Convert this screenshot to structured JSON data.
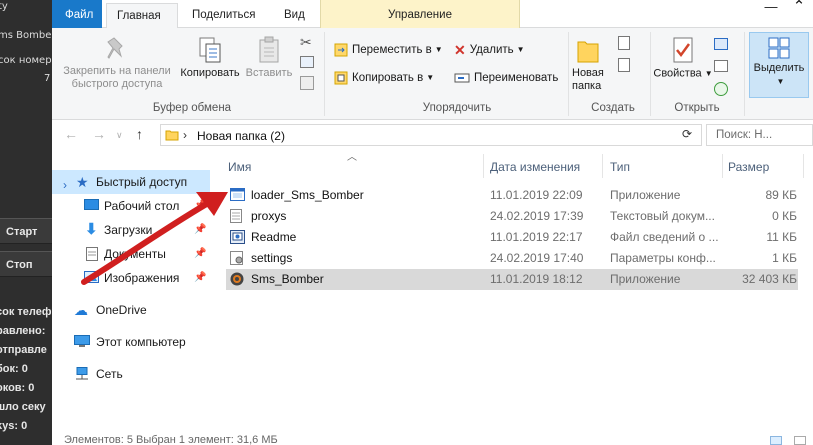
{
  "background_app": {
    "lines": [
      "ty",
      "ms Bombe",
      "сок номерс",
      "7"
    ],
    "buttons": [
      "Старт",
      "Стоп"
    ],
    "stats": [
      "сок телеф",
      "равлено:",
      "отправле",
      "бок: 0",
      "оков: 0",
      "шло секу",
      "kys: 0"
    ]
  },
  "tabs": {
    "file": "Файл",
    "home": "Главная",
    "share": "Поделиться",
    "view": "Вид",
    "manage": "Управление"
  },
  "ribbon": {
    "clipboard": {
      "pin": "Закрепить на панели быстрого доступа",
      "copy": "Копировать",
      "paste": "Вставить",
      "label": "Буфер обмена"
    },
    "organize": {
      "move_to": "Переместить в",
      "copy_to": "Копировать в",
      "delete": "Удалить",
      "rename": "Переименовать",
      "label": "Упорядочить"
    },
    "new": {
      "new_folder": "Новая папка",
      "label": "Создать"
    },
    "open": {
      "properties": "Свойства",
      "label": "Открыть"
    },
    "select": {
      "select": "Выделить"
    }
  },
  "address": {
    "path": "Новая папка (2)",
    "search_placeholder": "Поиск: Н..."
  },
  "nav": {
    "quick_access": "Быстрый доступ",
    "desktop": "Рабочий стол",
    "downloads": "Загрузки",
    "documents": "Документы",
    "pictures": "Изображения",
    "onedrive": "OneDrive",
    "this_pc": "Этот компьютер",
    "network": "Сеть"
  },
  "columns": {
    "name": "Имя",
    "date": "Дата изменения",
    "type": "Тип",
    "size": "Размер"
  },
  "files": [
    {
      "name": "loader_Sms_Bomber",
      "date": "11.01.2019 22:09",
      "type": "Приложение",
      "size": "89 КБ",
      "icon": "app-window-icon"
    },
    {
      "name": "proxys",
      "date": "24.02.2019 17:39",
      "type": "Текстовый докум...",
      "size": "0 КБ",
      "icon": "text-file-icon"
    },
    {
      "name": "Readme",
      "date": "11.01.2019 22:17",
      "type": "Файл сведений о ...",
      "size": "11 КБ",
      "icon": "info-file-icon"
    },
    {
      "name": "settings",
      "date": "24.02.2019 17:40",
      "type": "Параметры конф...",
      "size": "1 КБ",
      "icon": "settings-file-icon"
    },
    {
      "name": "Sms_Bomber",
      "date": "11.01.2019 18:12",
      "type": "Приложение",
      "size": "32 403 КБ",
      "icon": "bomber-app-icon",
      "selected": true
    }
  ],
  "status": {
    "text": "Элементов: 5   Выбран 1 элемент: 31,6 МБ"
  },
  "colors": {
    "file_tab": "#1979ca",
    "manage_tab": "#fdf3c9",
    "selection": "#d9d9d9",
    "quick_access_selected": "#cce8ff",
    "annotation_arrow": "#d01f1f"
  }
}
